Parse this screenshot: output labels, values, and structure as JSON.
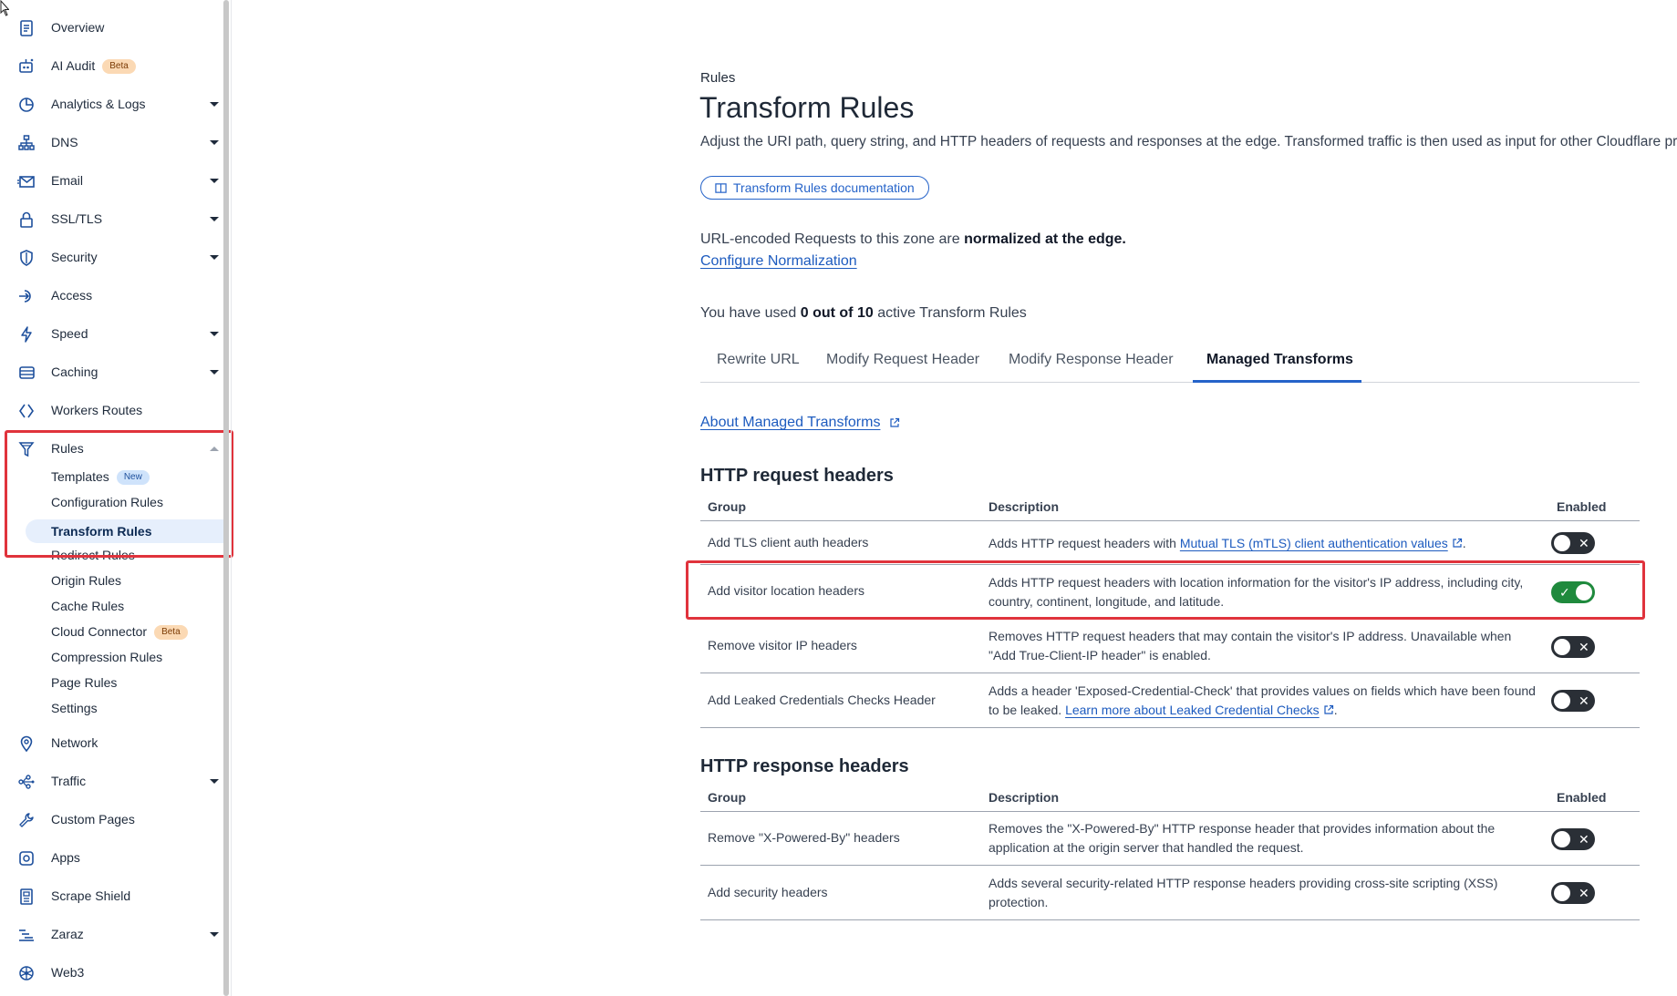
{
  "sidebar": {
    "items": [
      {
        "label": "Overview",
        "icon": "document-icon",
        "caret": false
      },
      {
        "label": "AI Audit",
        "icon": "robot-icon",
        "caret": false,
        "badge": "Beta"
      },
      {
        "label": "Analytics & Logs",
        "icon": "pie-chart-icon",
        "caret": true
      },
      {
        "label": "DNS",
        "icon": "network-tree-icon",
        "caret": true
      },
      {
        "label": "Email",
        "icon": "envelope-icon",
        "caret": true
      },
      {
        "label": "SSL/TLS",
        "icon": "lock-icon",
        "caret": true
      },
      {
        "label": "Security",
        "icon": "shield-icon",
        "caret": true
      },
      {
        "label": "Access",
        "icon": "login-icon",
        "caret": false
      },
      {
        "label": "Speed",
        "icon": "lightning-icon",
        "caret": true
      },
      {
        "label": "Caching",
        "icon": "server-stack-icon",
        "caret": true
      },
      {
        "label": "Workers Routes",
        "icon": "code-brackets-icon",
        "caret": false
      },
      {
        "label": "Rules",
        "icon": "funnel-icon",
        "caret": "up"
      }
    ],
    "rules_subitems": [
      {
        "label": "Templates",
        "badge": "New"
      },
      {
        "label": "Configuration Rules"
      },
      {
        "label": "Transform Rules",
        "active": true
      },
      {
        "label": "Redirect Rules"
      },
      {
        "label": "Origin Rules"
      },
      {
        "label": "Cache Rules"
      },
      {
        "label": "Cloud Connector",
        "badge": "Beta"
      },
      {
        "label": "Compression Rules"
      },
      {
        "label": "Page Rules"
      },
      {
        "label": "Settings"
      }
    ],
    "items_after": [
      {
        "label": "Network",
        "icon": "location-pin-icon",
        "caret": false
      },
      {
        "label": "Traffic",
        "icon": "traffic-nodes-icon",
        "caret": true
      },
      {
        "label": "Custom Pages",
        "icon": "wrench-icon",
        "caret": false
      },
      {
        "label": "Apps",
        "icon": "apps-icon",
        "caret": false
      },
      {
        "label": "Scrape Shield",
        "icon": "scrape-doc-icon",
        "caret": false
      },
      {
        "label": "Zaraz",
        "icon": "zaraz-icon",
        "caret": true
      },
      {
        "label": "Web3",
        "icon": "web3-icon",
        "caret": false
      }
    ]
  },
  "header": {
    "eyebrow": "Rules",
    "title": "Transform Rules",
    "description": "Adjust the URI path, query string, and HTTP headers of requests and responses at the edge. Transformed traffic is then used as input for other Cloudflare products.",
    "doc_button": "Transform Rules documentation"
  },
  "normalization": {
    "prefix": "URL-encoded Requests to this zone are ",
    "bold": "normalized at the edge.",
    "link": "Configure Normalization"
  },
  "usage": {
    "prefix": "You have used ",
    "bold": "0 out of 10",
    "suffix": " active Transform Rules"
  },
  "tabs": [
    "Rewrite URL",
    "Modify Request Header",
    "Modify Response Header",
    "Managed Transforms"
  ],
  "active_tab": "Managed Transforms",
  "about_link": "About Managed Transforms",
  "request_section": {
    "title": "HTTP request headers",
    "columns": [
      "Group",
      "Description",
      "Enabled"
    ],
    "rows": [
      {
        "group": "Add TLS client auth headers",
        "desc_prefix": "Adds HTTP request headers with ",
        "desc_link": "Mutual TLS (mTLS) client authentication values",
        "desc_suffix": ".",
        "enabled": false
      },
      {
        "group": "Add visitor location headers",
        "desc": "Adds HTTP request headers with location information for the visitor's IP address, including city, country, continent, longitude, and latitude.",
        "enabled": true
      },
      {
        "group": "Remove visitor IP headers",
        "desc": "Removes HTTP request headers that may contain the visitor's IP address. Unavailable when \"Add True-Client-IP header\" is enabled.",
        "enabled": false
      },
      {
        "group": "Add Leaked Credentials Checks Header",
        "desc_prefix": "Adds a header 'Exposed-Credential-Check' that provides values on fields which have been found to be leaked. ",
        "desc_link": "Learn more about Leaked Credential Checks",
        "desc_suffix": ".",
        "enabled": false
      }
    ]
  },
  "response_section": {
    "title": "HTTP response headers",
    "columns": [
      "Group",
      "Description",
      "Enabled"
    ],
    "rows": [
      {
        "group": "Remove \"X-Powered-By\" headers",
        "desc": "Removes the \"X-Powered-By\" HTTP response header that provides information about the application at the origin server that handled the request.",
        "enabled": false
      },
      {
        "group": "Add security headers",
        "desc": "Adds several security-related HTTP response headers providing cross-site scripting (XSS) protection.",
        "enabled": false
      }
    ]
  },
  "toggle_marks": {
    "on": "✓",
    "off": "✕"
  },
  "colors": {
    "accent": "#2563c9",
    "toggle_on": "#1f8a3d",
    "toggle_off": "#2a2f36",
    "highlight": "#e0333c"
  }
}
